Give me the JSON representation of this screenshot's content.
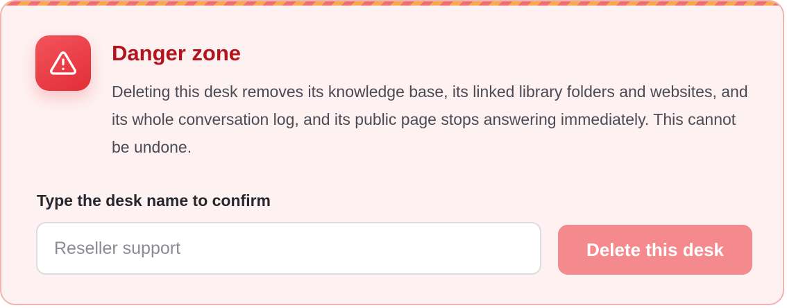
{
  "danger_zone": {
    "title": "Danger zone",
    "icon": "warning-triangle-icon",
    "description": "Deleting this desk removes its knowledge base, its linked library folders and websites, and its whole conversation log, and its public page stops answering immediately. This cannot be undone.",
    "confirm_label": "Type the desk name to confirm",
    "confirm_input": {
      "value": "",
      "placeholder": "Reseller support"
    },
    "delete_button_label": "Delete this desk",
    "delete_button_disabled": true
  },
  "colors": {
    "title": "#b3131d",
    "card_background": "#fef1f1",
    "card_border": "#efb4b0",
    "icon_tile": "#e22d38",
    "button_disabled": "#f4898e",
    "stripe_a": "#f06d74",
    "stripe_b": "#f7a94f"
  }
}
